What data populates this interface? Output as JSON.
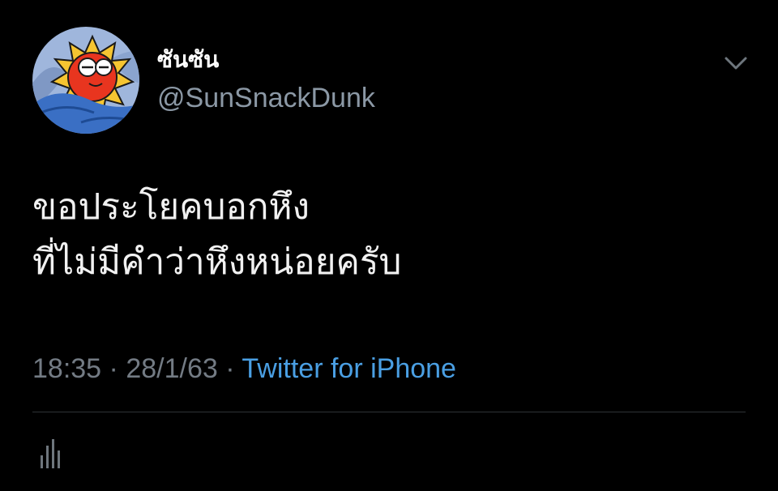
{
  "tweet": {
    "display_name": "ซันซัน",
    "handle": "@SunSnackDunk",
    "text_lines": [
      "ขอประโยคบอกหึง",
      "ที่ไม่มีคำว่าหึงหน่อยครับ"
    ],
    "time": "18:35",
    "date": "28/1/63",
    "separator": "·",
    "source": "Twitter for iPhone"
  },
  "icons": {
    "avatar": "sun-character-avatar",
    "more": "chevron-down-icon",
    "analytics": "analytics-bars-icon"
  },
  "colors": {
    "background": "#000000",
    "name": "#ffffff",
    "handle": "#8b98a5",
    "meta": "#737b84",
    "source_link": "#4a9fe3",
    "divider": "#2f3336"
  }
}
